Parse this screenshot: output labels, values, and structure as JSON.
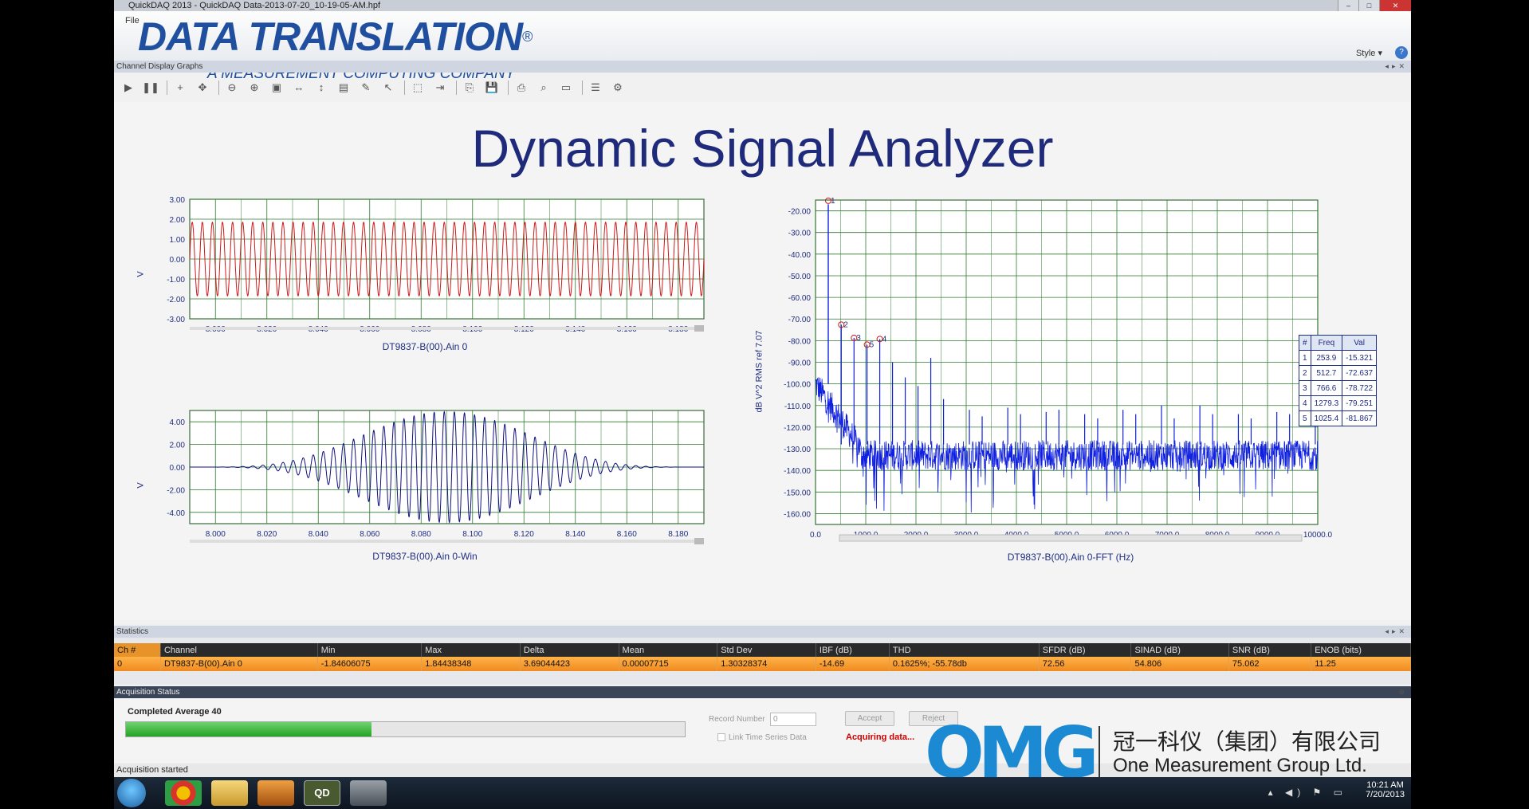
{
  "window": {
    "title": "QuickDAQ 2013 - QuickDAQ Data-2013-07-20_10-19-05-AM.hpf",
    "menu_file": "File",
    "style_menu": "Style ▾",
    "doc_tab": "Channel Display   Graphs"
  },
  "logo": {
    "brand": "DATA TRANSLATION",
    "registered": "®",
    "tagline": "A MEASUREMENT COMPUTING COMPANY"
  },
  "slide": {
    "title": "Dynamic Signal Analyzer"
  },
  "chart_data": [
    {
      "type": "line",
      "name_label": "DT9837-B(00).Ain 0",
      "ylabel": "V",
      "x_ticks": [
        "8.000",
        "8.020",
        "8.040",
        "8.060",
        "8.080",
        "8.100",
        "8.120",
        "8.140",
        "8.160",
        "8.180"
      ],
      "y_ticks": [
        "3.00",
        "2.00",
        "1.00",
        "0.00",
        "-1.00",
        "-2.00",
        "-3.00"
      ],
      "xlim": [
        7.99,
        8.19
      ],
      "ylim": [
        -3.0,
        3.0
      ],
      "series": [
        {
          "amplitude": 1.85,
          "cycles": 51,
          "color": "#d01818"
        }
      ],
      "grid": true
    },
    {
      "type": "line",
      "name_label": "DT9837-B(00).Ain 0-Win",
      "ylabel": "V",
      "x_ticks": [
        "8.000",
        "8.020",
        "8.040",
        "8.060",
        "8.080",
        "8.100",
        "8.120",
        "8.140",
        "8.160",
        "8.180"
      ],
      "y_ticks": [
        "4.00",
        "2.00",
        "0.00",
        "-2.00",
        "-4.00"
      ],
      "xlim": [
        7.99,
        8.19
      ],
      "ylim": [
        -5.0,
        5.0
      ],
      "series": [
        {
          "amplitude": 4.9,
          "cycles": 51,
          "window": "hanning",
          "color": "#101080"
        }
      ],
      "grid": true
    },
    {
      "type": "line",
      "name_label": "DT9837-B(00).Ain 0-FFT (Hz)",
      "ylabel": "dB V^2 RMS ref 7.07",
      "x_ticks": [
        "0.0",
        "1000.0",
        "2000.0",
        "3000.0",
        "4000.0",
        "5000.0",
        "6000.0",
        "7000.0",
        "8000.0",
        "9000.0",
        "10000.0"
      ],
      "y_ticks": [
        "-20.00",
        "-30.00",
        "-40.00",
        "-50.00",
        "-60.00",
        "-70.00",
        "-80.00",
        "-90.00",
        "-100.00",
        "-110.00",
        "-120.00",
        "-130.00",
        "-140.00",
        "-150.00",
        "-160.00"
      ],
      "xlim": [
        0,
        10000
      ],
      "ylim": [
        -165,
        -15
      ],
      "series": [
        {
          "noise_floor": -133,
          "fundamental_hz": 253.9,
          "color": "#1020e0"
        }
      ],
      "harmonics": [
        {
          "freq": 512.7,
          "db": -72.6
        },
        {
          "freq": 766.6,
          "db": -78.7
        },
        {
          "freq": 1025.4,
          "db": -81.9
        },
        {
          "freq": 1279.3,
          "db": -79.3
        },
        {
          "freq": 1533,
          "db": -90
        },
        {
          "freq": 1787,
          "db": -97
        },
        {
          "freq": 2041,
          "db": -101
        },
        {
          "freq": 2295,
          "db": -88
        },
        {
          "freq": 2549,
          "db": -107
        },
        {
          "freq": 3064,
          "db": -112
        },
        {
          "freq": 3318,
          "db": -115
        },
        {
          "freq": 3828,
          "db": -111
        },
        {
          "freq": 4082,
          "db": -114
        },
        {
          "freq": 4592,
          "db": -113
        },
        {
          "freq": 4846,
          "db": -112
        },
        {
          "freq": 5359,
          "db": -114
        },
        {
          "freq": 5618,
          "db": -116
        },
        {
          "freq": 6122,
          "db": -112
        },
        {
          "freq": 6376,
          "db": -114
        },
        {
          "freq": 6888,
          "db": -110
        },
        {
          "freq": 7142,
          "db": -116
        },
        {
          "freq": 7653,
          "db": -110
        },
        {
          "freq": 7907,
          "db": -114
        },
        {
          "freq": 8420,
          "db": -114
        },
        {
          "freq": 8674,
          "db": -116
        },
        {
          "freq": 9185,
          "db": -113
        },
        {
          "freq": 9439,
          "db": -114
        },
        {
          "freq": 9951,
          "db": -113
        }
      ],
      "markers": [
        {
          "n": "1",
          "freq": "253.9",
          "val": "-15.321"
        },
        {
          "n": "2",
          "freq": "512.7",
          "val": "-72.637"
        },
        {
          "n": "3",
          "freq": "766.6",
          "val": "-78.722"
        },
        {
          "n": "4",
          "freq": "1279.3",
          "val": "-79.251"
        },
        {
          "n": "5",
          "freq": "1025.4",
          "val": "-81.867"
        }
      ],
      "marker_headers": [
        "#",
        "Freq",
        "Val"
      ],
      "grid": true
    }
  ],
  "statistics": {
    "header": "Statistics",
    "columns": [
      "Ch #",
      "Channel",
      "Min",
      "Max",
      "Delta",
      "Mean",
      "Std Dev",
      "IBF (dB)",
      "THD",
      "SFDR (dB)",
      "SINAD (dB)",
      "SNR (dB)",
      "ENOB (bits)"
    ],
    "row": [
      "0",
      "DT9837-B(00).Ain 0",
      "-1.84606075",
      "1.84438348",
      "3.69044423",
      "0.00007715",
      "1.30328374",
      "-14.69",
      "0.1625%; -55.78db",
      "72.56",
      "54.806",
      "75.062",
      "11.25"
    ]
  },
  "acquisition": {
    "header": "Acquisition Status",
    "label": "Completed Average 40",
    "progress": 0.44,
    "record_label": "Record Number",
    "record_value": "0",
    "accept": "Accept",
    "reject": "Reject",
    "link": "Link Time Series Data",
    "acquiring": "Acquiring data..."
  },
  "statusbar": {
    "text": "Acquisition started"
  },
  "watermark": {
    "logo": "OMG",
    "cn": "冠一科仪（集团）有限公司",
    "en": "One Measurement Group Ltd."
  },
  "taskbar": {
    "time": "10:21 AM",
    "date": "7/20/2013",
    "app_qd": "QD"
  }
}
